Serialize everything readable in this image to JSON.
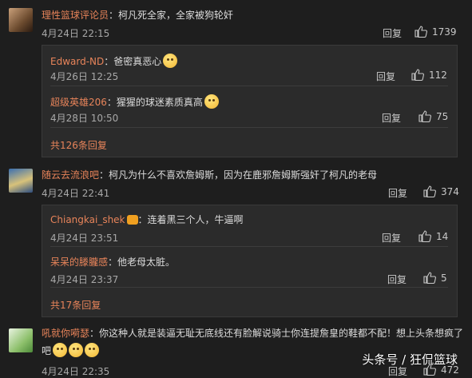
{
  "comments": [
    {
      "author": "理性篮球评论员",
      "text": "柯凡死全家，全家被狗轮奸",
      "date": "4月24日 22:15",
      "reply_label": "回复",
      "likes": "1739",
      "replies": [
        {
          "author": "Edward-ND",
          "text": "爸密真恶心",
          "date": "4月26日 12:25",
          "reply_label": "回复",
          "likes": "112"
        },
        {
          "author": "超级英雄206",
          "text": "猩猩的球迷素质真高",
          "date": "4月28日 10:50",
          "reply_label": "回复",
          "likes": "75"
        }
      ],
      "more_label": "共126条回复"
    },
    {
      "author": "随云去流浪吧",
      "text": "柯凡为什么不喜欢詹姆斯，因为在鹿邪詹姆斯强奸了柯凡的老母",
      "date": "4月24日 22:41",
      "reply_label": "回复",
      "likes": "374",
      "replies": [
        {
          "author": "Chiangkai_shek",
          "text": "连着黑三个人，牛逼啊",
          "date": "4月24日 23:51",
          "reply_label": "回复",
          "likes": "14"
        },
        {
          "author": "呆呆的滕朧感",
          "text": "他老母太脏。",
          "date": "4月24日 23:37",
          "reply_label": "回复",
          "likes": "5"
        }
      ],
      "more_label": "共17条回复"
    },
    {
      "author": "吼就你嗬瑟",
      "text": "你这种人就是装逼无耻无底线还有脸解说骑士你连提詹皇的鞋都不配！想上头条想疯了吧",
      "date": "4月24日 22:35",
      "reply_label": "回复",
      "likes": "472"
    }
  ],
  "watermark": "头条号 / 狂侃篮球",
  "colors": {
    "background": "#1e1e1e",
    "username": "#e8845a",
    "subbox": "#2b2b2b"
  }
}
